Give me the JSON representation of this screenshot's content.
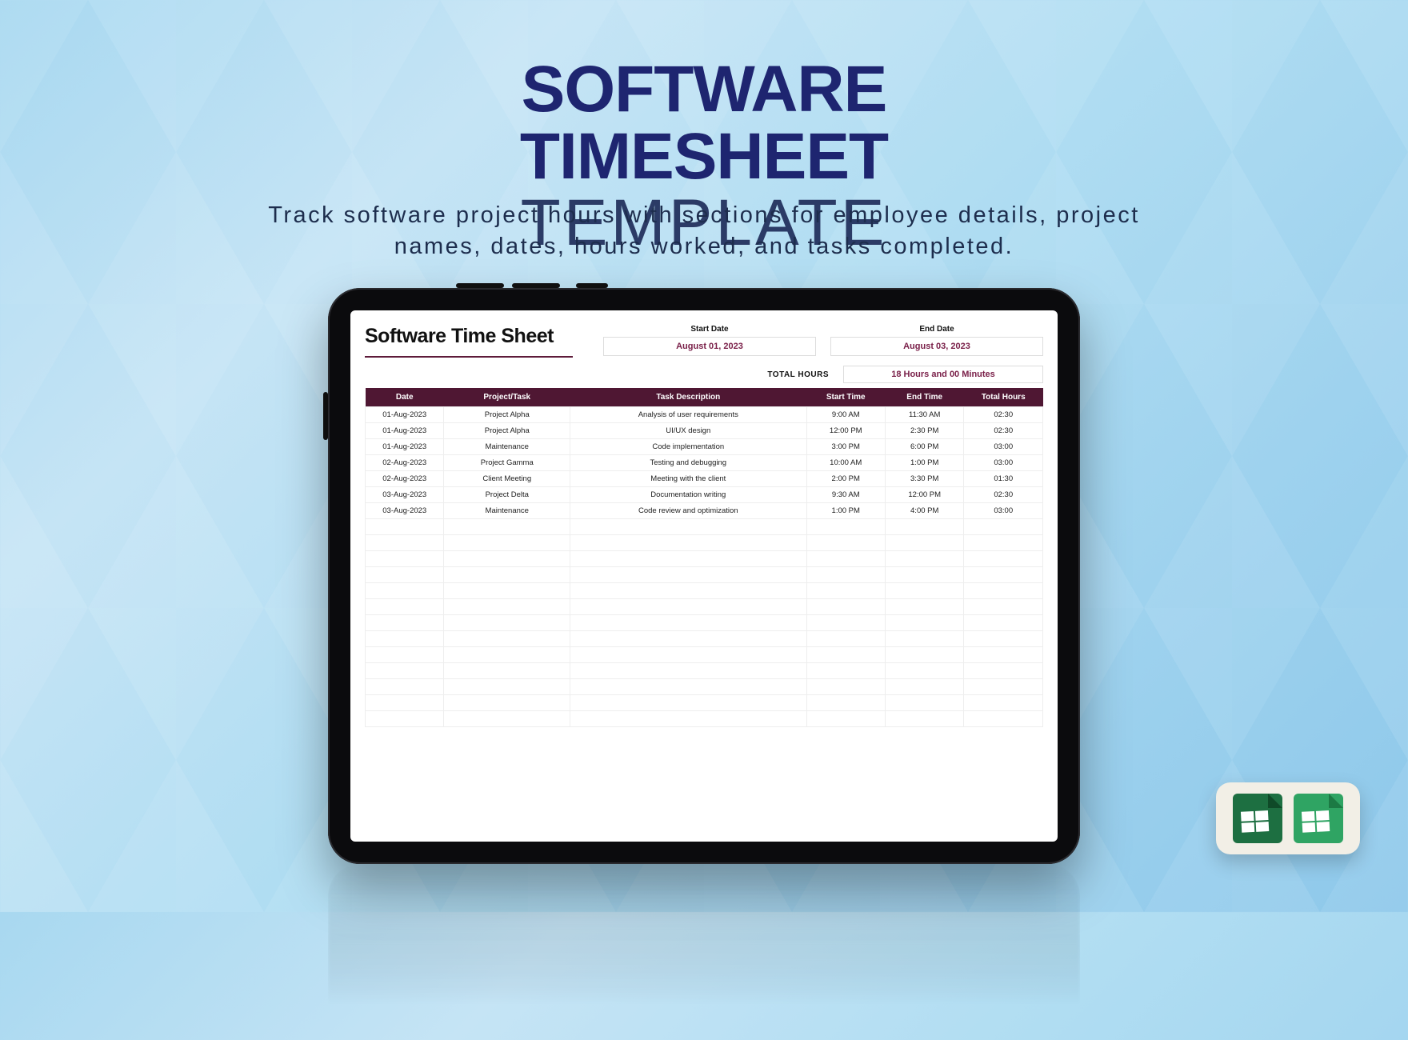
{
  "hero": {
    "line1": "SOFTWARE",
    "line2_bold": "TIMESHEET",
    "line2_light": " TEMPLATE"
  },
  "subtitle": "Track software project hours with sections for employee details, project names, dates, hours worked, and tasks completed.",
  "sheet": {
    "title": "Software Time Sheet",
    "start_date_label": "Start Date",
    "start_date": "August 01, 2023",
    "end_date_label": "End Date",
    "end_date": "August 03, 2023",
    "total_hours_label": "TOTAL HOURS",
    "total_hours_value": "18 Hours and 00 Minutes",
    "columns": {
      "date": "Date",
      "project": "Project/Task",
      "desc": "Task Description",
      "start": "Start Time",
      "end": "End Time",
      "total": "Total Hours"
    },
    "rows": [
      {
        "date": "01-Aug-2023",
        "project": "Project Alpha",
        "desc": "Analysis of user requirements",
        "start": "9:00 AM",
        "end": "11:30 AM",
        "total": "02:30"
      },
      {
        "date": "01-Aug-2023",
        "project": "Project Alpha",
        "desc": "UI/UX design",
        "start": "12:00 PM",
        "end": "2:30 PM",
        "total": "02:30"
      },
      {
        "date": "01-Aug-2023",
        "project": "Maintenance",
        "desc": "Code implementation",
        "start": "3:00 PM",
        "end": "6:00 PM",
        "total": "03:00"
      },
      {
        "date": "02-Aug-2023",
        "project": "Project Gamma",
        "desc": "Testing and debugging",
        "start": "10:00 AM",
        "end": "1:00 PM",
        "total": "03:00"
      },
      {
        "date": "02-Aug-2023",
        "project": "Client Meeting",
        "desc": "Meeting with the client",
        "start": "2:00 PM",
        "end": "3:30 PM",
        "total": "01:30"
      },
      {
        "date": "03-Aug-2023",
        "project": "Project Delta",
        "desc": "Documentation writing",
        "start": "9:30 AM",
        "end": "12:00 PM",
        "total": "02:30"
      },
      {
        "date": "03-Aug-2023",
        "project": "Maintenance",
        "desc": "Code review and optimization",
        "start": "1:00 PM",
        "end": "4:00 PM",
        "total": "03:00"
      }
    ],
    "empty_rows": 13
  },
  "icons": {
    "excel": "excel-icon",
    "sheets": "google-sheets-icon"
  }
}
